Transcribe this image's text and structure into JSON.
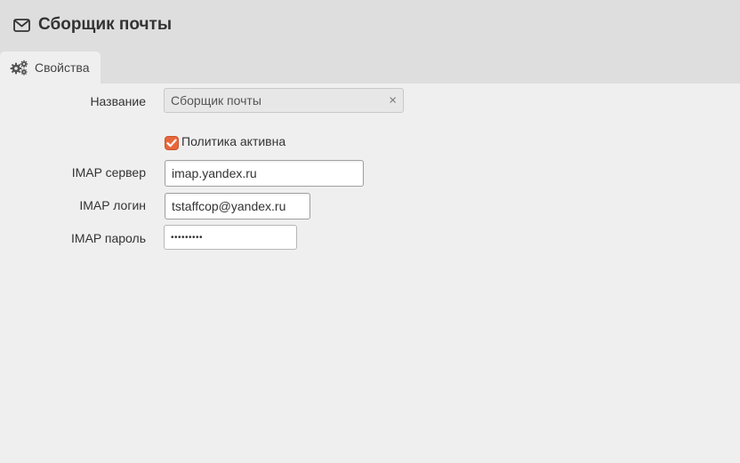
{
  "window": {
    "title": "Сборщик почты",
    "title_icon": "envelope-icon"
  },
  "tabs": [
    {
      "label": "Свойства",
      "icon": "gears-icon",
      "active": true
    }
  ],
  "form": {
    "name": {
      "label": "Название",
      "value": "Сборщик почты",
      "clear_icon": "×"
    },
    "policy_active": {
      "label": "Политика активна",
      "checked": true,
      "accent": "#e8673a"
    },
    "imap_server": {
      "label": "IMAP сервер",
      "value": "imap.yandex.ru"
    },
    "imap_login": {
      "label": "IMAP логин",
      "value": "tstaffcop@yandex.ru"
    },
    "imap_password": {
      "label": "IMAP пароль",
      "value": "•••••••••"
    }
  }
}
